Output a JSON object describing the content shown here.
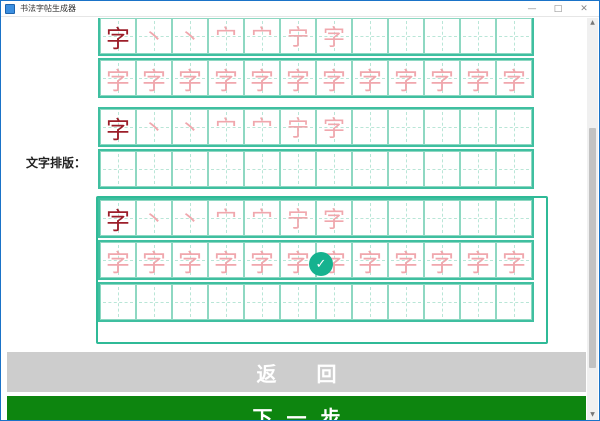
{
  "window": {
    "title": "书法字帖生成器",
    "minimize": "—",
    "maximize": "□",
    "close": "✕"
  },
  "label": {
    "text": "文字排版："
  },
  "strokes": [
    "字",
    "丶",
    "丶",
    "宀",
    "宀",
    "宁",
    "字"
  ],
  "light_char": "字",
  "buttons": {
    "back": "返回",
    "next": "下一步"
  },
  "check_mark": "✓",
  "colors": {
    "accent": "#2fba97",
    "grid": "#8ed8c2",
    "dark_char": "#9c1e2a",
    "light_char": "#f0a7ad",
    "next_btn": "#0d850f",
    "back_btn": "#cdcdcd"
  }
}
